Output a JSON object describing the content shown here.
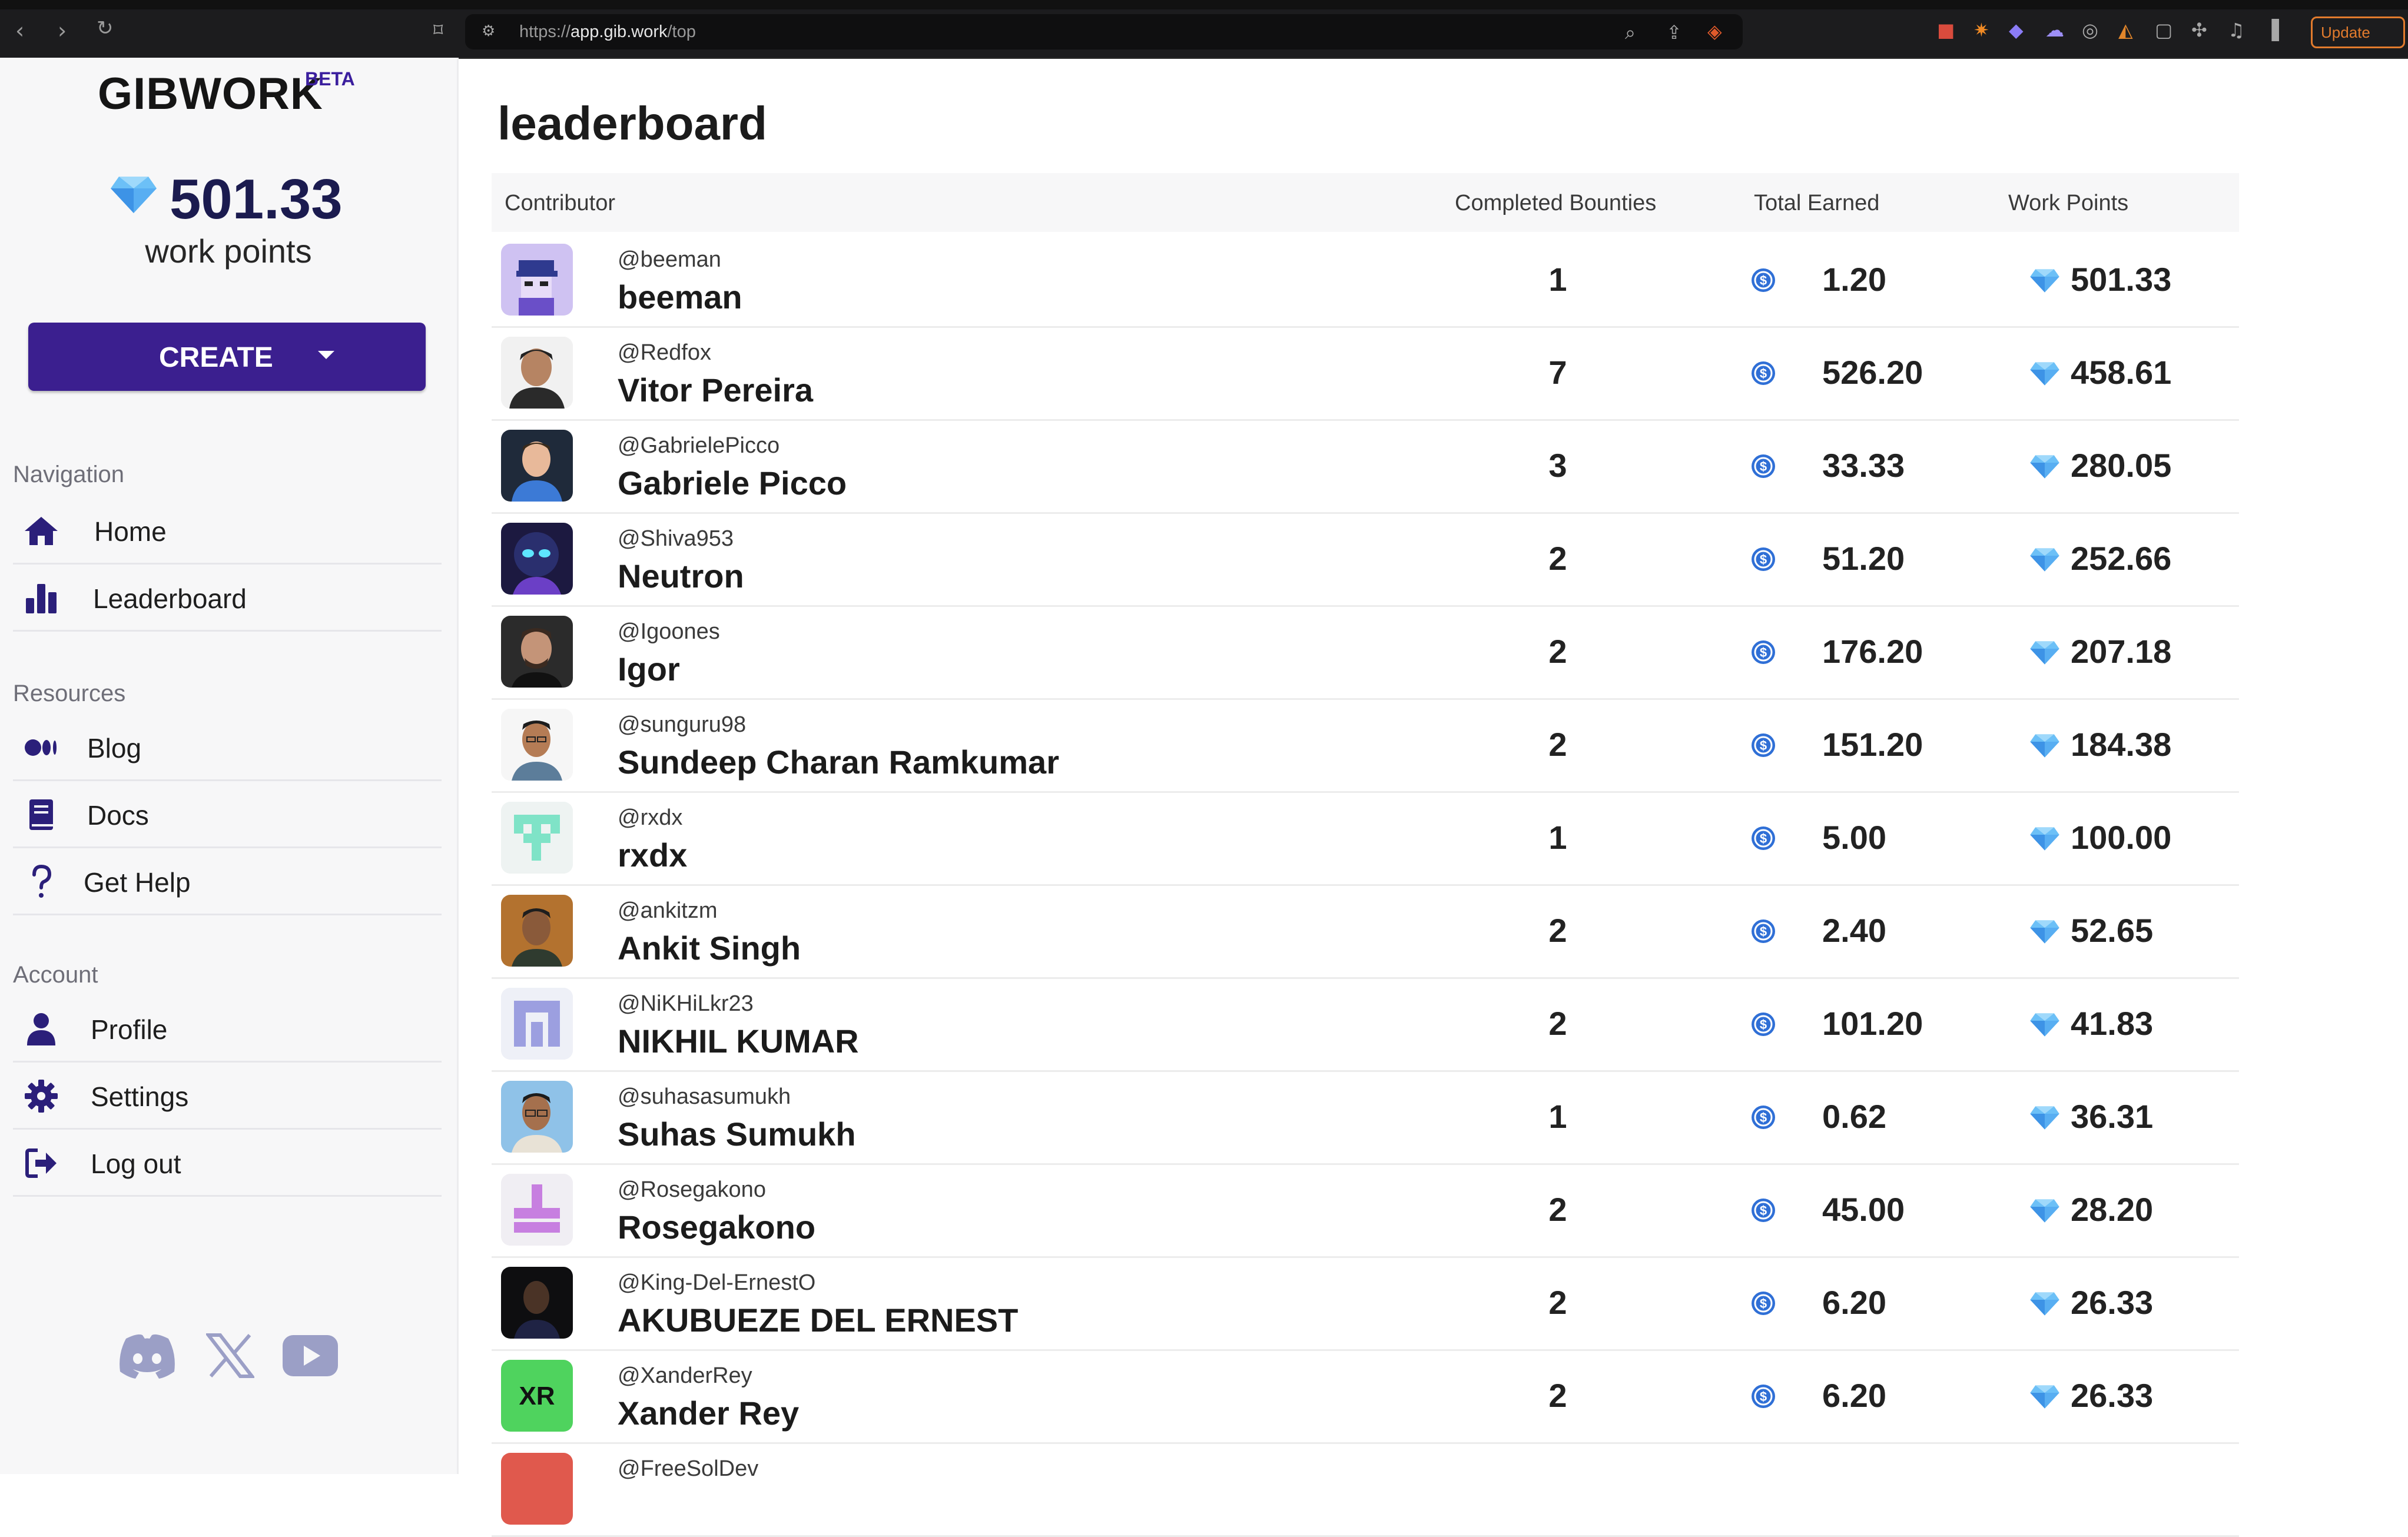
{
  "browser": {
    "url_prefix": "https://",
    "url_host": "app.gib.work",
    "url_path": "/top",
    "update_label": "Update"
  },
  "sidebar": {
    "brand": "GIBWORK",
    "beta": "BETA",
    "work_points_value": "501.33",
    "work_points_label": "work points",
    "create_label": "CREATE",
    "sections": {
      "navigation": "Navigation",
      "resources": "Resources",
      "account": "Account"
    },
    "nav_items": {
      "home": "Home",
      "leaderboard": "Leaderboard",
      "blog": "Blog",
      "docs": "Docs",
      "help": "Get Help",
      "profile": "Profile",
      "settings": "Settings",
      "logout": "Log out"
    },
    "socials": [
      "discord-icon",
      "x-icon",
      "youtube-icon"
    ]
  },
  "main": {
    "title": "leaderboard",
    "columns": {
      "contributor": "Contributor",
      "completed": "Completed Bounties",
      "earned": "Total Earned",
      "points": "Work Points"
    },
    "rows": [
      {
        "handle": "@beeman",
        "name": "beeman",
        "bounties": "1",
        "earned": "1.20",
        "points": "501.33"
      },
      {
        "handle": "@Redfox",
        "name": "Vitor Pereira",
        "bounties": "7",
        "earned": "526.20",
        "points": "458.61"
      },
      {
        "handle": "@GabrielePicco",
        "name": "Gabriele Picco",
        "bounties": "3",
        "earned": "33.33",
        "points": "280.05"
      },
      {
        "handle": "@Shiva953",
        "name": "Neutron",
        "bounties": "2",
        "earned": "51.20",
        "points": "252.66"
      },
      {
        "handle": "@Igoones",
        "name": "Igor",
        "bounties": "2",
        "earned": "176.20",
        "points": "207.18"
      },
      {
        "handle": "@sunguru98",
        "name": "Sundeep Charan Ramkumar",
        "bounties": "2",
        "earned": "151.20",
        "points": "184.38"
      },
      {
        "handle": "@rxdx",
        "name": "rxdx",
        "bounties": "1",
        "earned": "5.00",
        "points": "100.00"
      },
      {
        "handle": "@ankitzm",
        "name": "Ankit Singh",
        "bounties": "2",
        "earned": "2.40",
        "points": "52.65"
      },
      {
        "handle": "@NiKHiLkr23",
        "name": "NIKHIL KUMAR",
        "bounties": "2",
        "earned": "101.20",
        "points": "41.83"
      },
      {
        "handle": "@suhasasumukh",
        "name": "Suhas Sumukh",
        "bounties": "1",
        "earned": "0.62",
        "points": "36.31"
      },
      {
        "handle": "@Rosegakono",
        "name": "Rosegakono",
        "bounties": "2",
        "earned": "45.00",
        "points": "28.20"
      },
      {
        "handle": "@King-Del-ErnestO",
        "name": "AKUBUEZE DEL ERNEST",
        "bounties": "2",
        "earned": "6.20",
        "points": "26.33"
      },
      {
        "handle": "@XanderRey",
        "name": "Xander Rey",
        "bounties": "2",
        "earned": "6.20",
        "points": "26.33"
      },
      {
        "handle": "@FreeSolDev",
        "name": "",
        "bounties": "",
        "earned": "",
        "points": ""
      }
    ]
  },
  "colors": {
    "brand_purple": "#3b1f8f",
    "coin_blue": "#2f6fd6",
    "gem_blue": "#5aa8f0",
    "update_orange": "#e27b2d"
  }
}
